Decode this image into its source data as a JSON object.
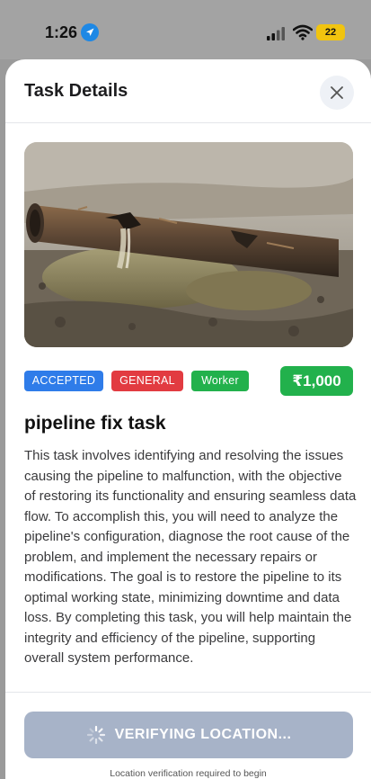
{
  "status_bar": {
    "time": "1:26",
    "battery": "22",
    "icons": [
      "location-arrow-icon",
      "signal-icon",
      "wifi-icon",
      "battery-icon"
    ]
  },
  "sheet": {
    "title": "Task Details",
    "close_icon": "close-icon"
  },
  "task": {
    "image": "burst-pipeline-photo",
    "tags": [
      {
        "label": "ACCEPTED",
        "color": "#2f7ce9"
      },
      {
        "label": "GENERAL",
        "color": "#e23b41"
      },
      {
        "label": "Worker",
        "color": "#22b14c"
      }
    ],
    "price": "₹1,000",
    "price_color": "#22b14c",
    "title": "pipeline fix task",
    "description": "This task involves identifying and resolving the issues causing the pipeline to malfunction, with the objective of restoring its functionality and ensuring seamless data flow. To accomplish this, you will need to analyze the pipeline's configuration, diagnose the root cause of the problem, and implement the necessary repairs or modifications. The goal is to restore the pipeline to its optimal working state, minimizing downtime and data loss. By completing this task, you will help maintain the integrity and efficiency of the pipeline, supporting overall system performance."
  },
  "action": {
    "button_label": "VERIFYING LOCATION...",
    "button_color": "#a7b3c8",
    "spinner_icon": "spinner-icon",
    "note": "Location verification required to begin"
  }
}
